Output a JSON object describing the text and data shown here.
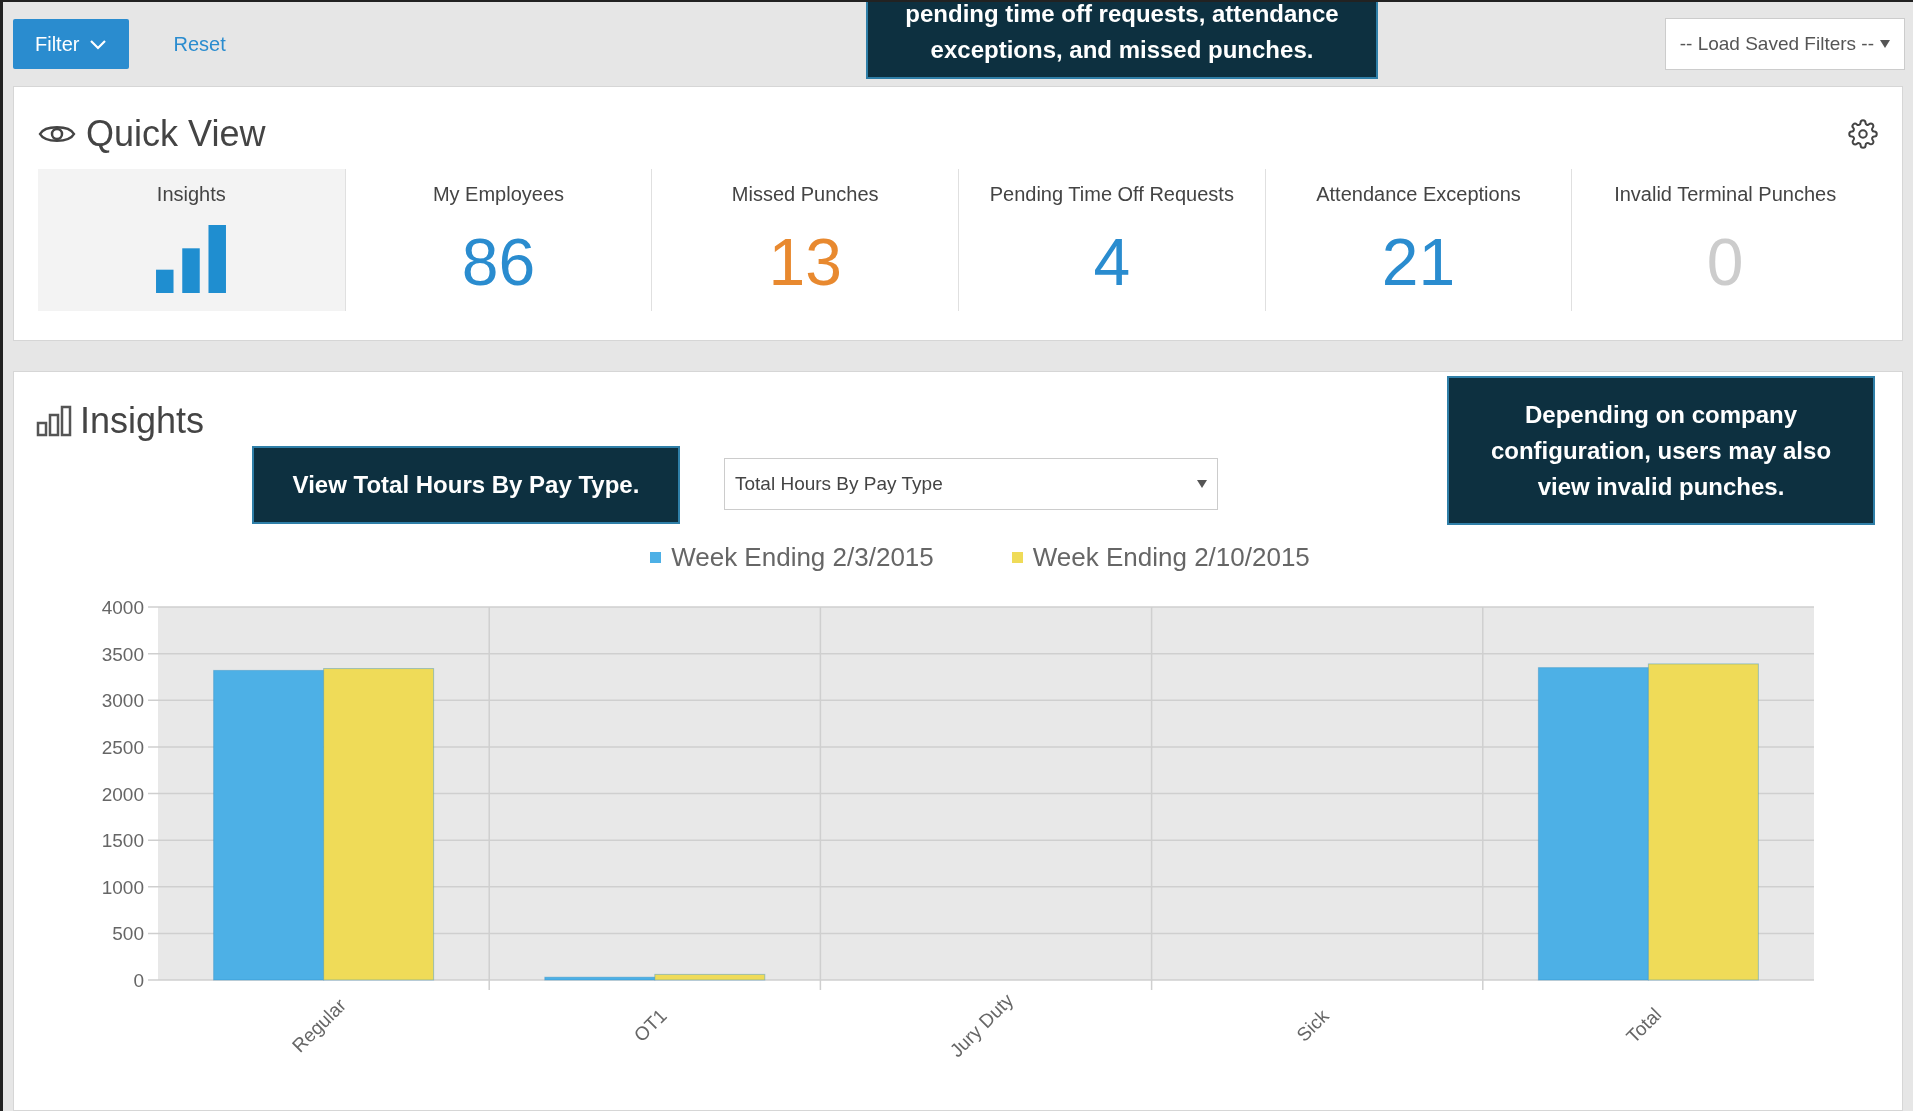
{
  "toolbar": {
    "filter_button": "Filter",
    "reset_link": "Reset",
    "saved_filters": "-- Load Saved Filters --"
  },
  "callouts": [
    {
      "kind": "top",
      "lines": [
        "pending time off requests, attendance",
        "exceptions, and missed punches."
      ]
    },
    {
      "kind": "left",
      "lines": [
        "View Total Hours By Pay Type."
      ]
    },
    {
      "kind": "right",
      "lines": [
        "Depending on company",
        "configuration, users may also",
        "view invalid punches."
      ]
    }
  ],
  "quick_view": {
    "title": "Quick View",
    "tiles": [
      {
        "kind": "icon",
        "label": "Insights",
        "selected": true
      },
      {
        "kind": "count",
        "label": "My Employees",
        "value": "86",
        "color": "#2a8ccf",
        "selected": false
      },
      {
        "kind": "count",
        "label": "Missed Punches",
        "value": "13",
        "color": "#e8892f",
        "selected": false
      },
      {
        "kind": "count",
        "label": "Pending Time Off Requests",
        "value": "4",
        "color": "#2a8ccf",
        "selected": false
      },
      {
        "kind": "count",
        "label": "Attendance Exceptions",
        "value": "21",
        "color": "#2a8ccf",
        "selected": false
      },
      {
        "kind": "count",
        "label": "Invalid Terminal Punches",
        "value": "0",
        "color": "#cccccc",
        "selected": false
      }
    ]
  },
  "insights": {
    "title": "Insights",
    "report_select": "Total Hours By Pay Type",
    "chart_data": {
      "type": "bar",
      "categories": [
        "Regular",
        "OT1",
        "Jury Duty",
        "Sick",
        "Total"
      ],
      "series": [
        {
          "name": "Week Ending 2/3/2015",
          "color": "#4db0e6",
          "values": [
            3320,
            30,
            0,
            0,
            3350
          ]
        },
        {
          "name": "Week Ending 2/10/2015",
          "color": "#efdb58",
          "values": [
            3340,
            60,
            0,
            0,
            3390
          ]
        }
      ],
      "grid": true,
      "legend": "top",
      "ylim": [
        0,
        4000
      ],
      "yticks": [
        0,
        500,
        1000,
        1500,
        2000,
        2500,
        3000,
        3500,
        4000
      ]
    }
  }
}
